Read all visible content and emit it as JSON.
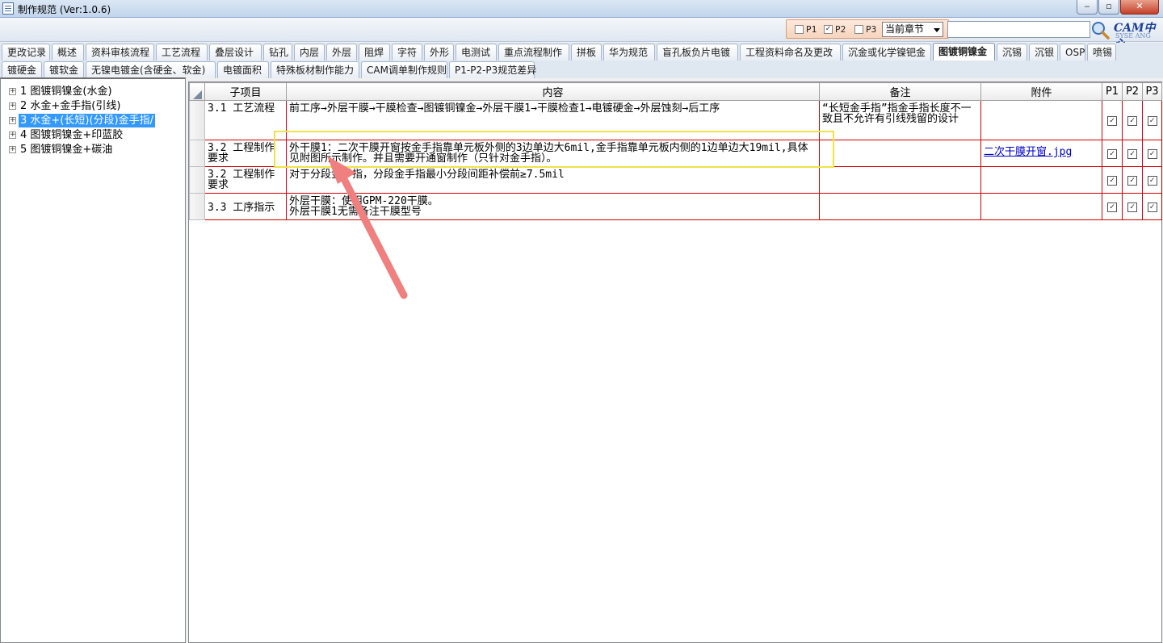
{
  "window": {
    "title": "制作规范 (Ver:1.0.6)",
    "min_label": "‒",
    "max_label": "▫",
    "close_label": "✕"
  },
  "toolbar": {
    "p1_label": "P1",
    "p2_label": "P2",
    "p3_label": "P3",
    "p1_checked": false,
    "p2_checked": true,
    "p3_checked": false,
    "scope_select_value": "当前章节",
    "search_value": "",
    "logo_text": "CAM中心",
    "logo_sub": "SYSE ANG"
  },
  "tabs_row1": [
    "更改记录",
    "概述",
    "资料审核流程",
    "工艺流程",
    "叠层设计",
    "钻孔",
    "内层",
    "外层",
    "阻焊",
    "字符",
    "外形",
    "电测试",
    "重点流程制作",
    "拼板",
    "华为规范",
    "盲孔板负片电镀",
    "工程资料命名及更改",
    "沉金或化学镍钯金",
    "图镀铜镍金",
    "沉锡",
    "沉银",
    "OSP",
    "喷锡"
  ],
  "active_tab": "图镀铜镍金",
  "tabs_row2": [
    "镀硬金",
    "镀软金",
    "无镍电镀金(含硬金、软金)",
    "电镀面积",
    "特殊板材制作能力",
    "CAM调单制作规则",
    "P1-P2-P3规范差异"
  ],
  "tree": [
    {
      "label": "1 图镀铜镍金(水金)",
      "selected": false
    },
    {
      "label": "2 水金+金手指(引线)",
      "selected": false
    },
    {
      "label": "3 水金+(长短)(分段)金手指/",
      "selected": true
    },
    {
      "label": "4 图镀铜镍金+印蓝胶",
      "selected": false
    },
    {
      "label": "5 图镀铜镍金+碳油",
      "selected": false
    }
  ],
  "grid": {
    "headers": {
      "sub": "子项目",
      "content": "内容",
      "remark": "备注",
      "attach": "附件",
      "p1": "P1",
      "p2": "P2",
      "p3": "P3"
    },
    "rows": [
      {
        "sub": "3.1 工艺流程",
        "content": "前工序→外层干膜→干膜检查→图镀铜镍金→外层干膜1→干膜检查1→电镀硬金→外层蚀刻→后工序",
        "remark": "“长短金手指”指金手指长度不一致且不允许有引线残留的设计",
        "attach": "",
        "p1": true,
        "p2": true,
        "p3": true
      },
      {
        "sub": "3.2 工程制作要求",
        "content": "外干膜1：二次干膜开窗按金手指靠单元板外侧的3边单边大6mil,金手指靠单元板内侧的1边单边大19mil,具体见附图所示制作。并且需要开通窗制作（只针对金手指）。",
        "remark": "",
        "attach": "二次干膜开窗.jpg",
        "p1": true,
        "p2": true,
        "p3": true
      },
      {
        "sub": "3.2 工程制作要求",
        "content": "对于分段金手指，分段金手指最小分段间距补偿前≥7.5mil",
        "remark": "",
        "attach": "",
        "p1": true,
        "p2": true,
        "p3": true
      },
      {
        "sub": "3.3 工序指示",
        "content": "外层干膜：使用GPM-220干膜。\n外层干膜1无需备注干膜型号",
        "remark": "",
        "attach": "",
        "p1": true,
        "p2": true,
        "p3": true
      }
    ]
  },
  "colors": {
    "highlight": "#f0e34a",
    "arrow": "#f08080",
    "grid_line": "#d10000",
    "selected": "#3399ff"
  }
}
